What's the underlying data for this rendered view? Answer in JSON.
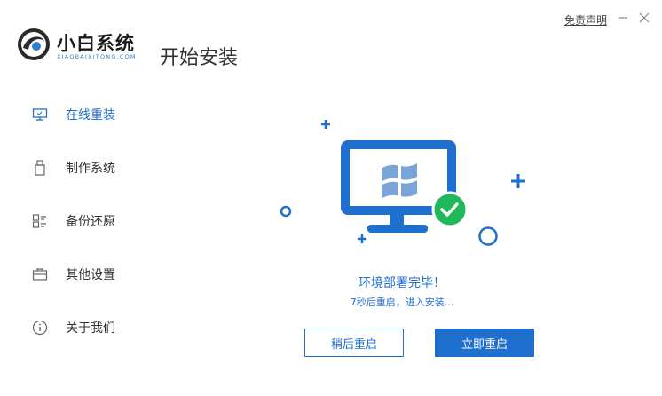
{
  "brand": {
    "name": "小白系统",
    "domain": "XIAOBAIXITONG.COM"
  },
  "header": {
    "title": "开始安装",
    "disclaimer": "免责声明"
  },
  "sidebar": {
    "items": [
      {
        "label": "在线重装",
        "icon": "monitor-icon",
        "active": true
      },
      {
        "label": "制作系统",
        "icon": "usb-icon",
        "active": false
      },
      {
        "label": "备份还原",
        "icon": "backup-icon",
        "active": false
      },
      {
        "label": "其他设置",
        "icon": "briefcase-icon",
        "active": false
      },
      {
        "label": "关于我们",
        "icon": "info-icon",
        "active": false
      }
    ]
  },
  "status": {
    "title": "环境部署完毕！",
    "subtitle": "7秒后重启，进入安装..."
  },
  "buttons": {
    "later": "稍后重启",
    "now": "立即重启"
  },
  "colors": {
    "accent": "#1f6fce",
    "success": "#1fb85a",
    "text": "#333333"
  }
}
